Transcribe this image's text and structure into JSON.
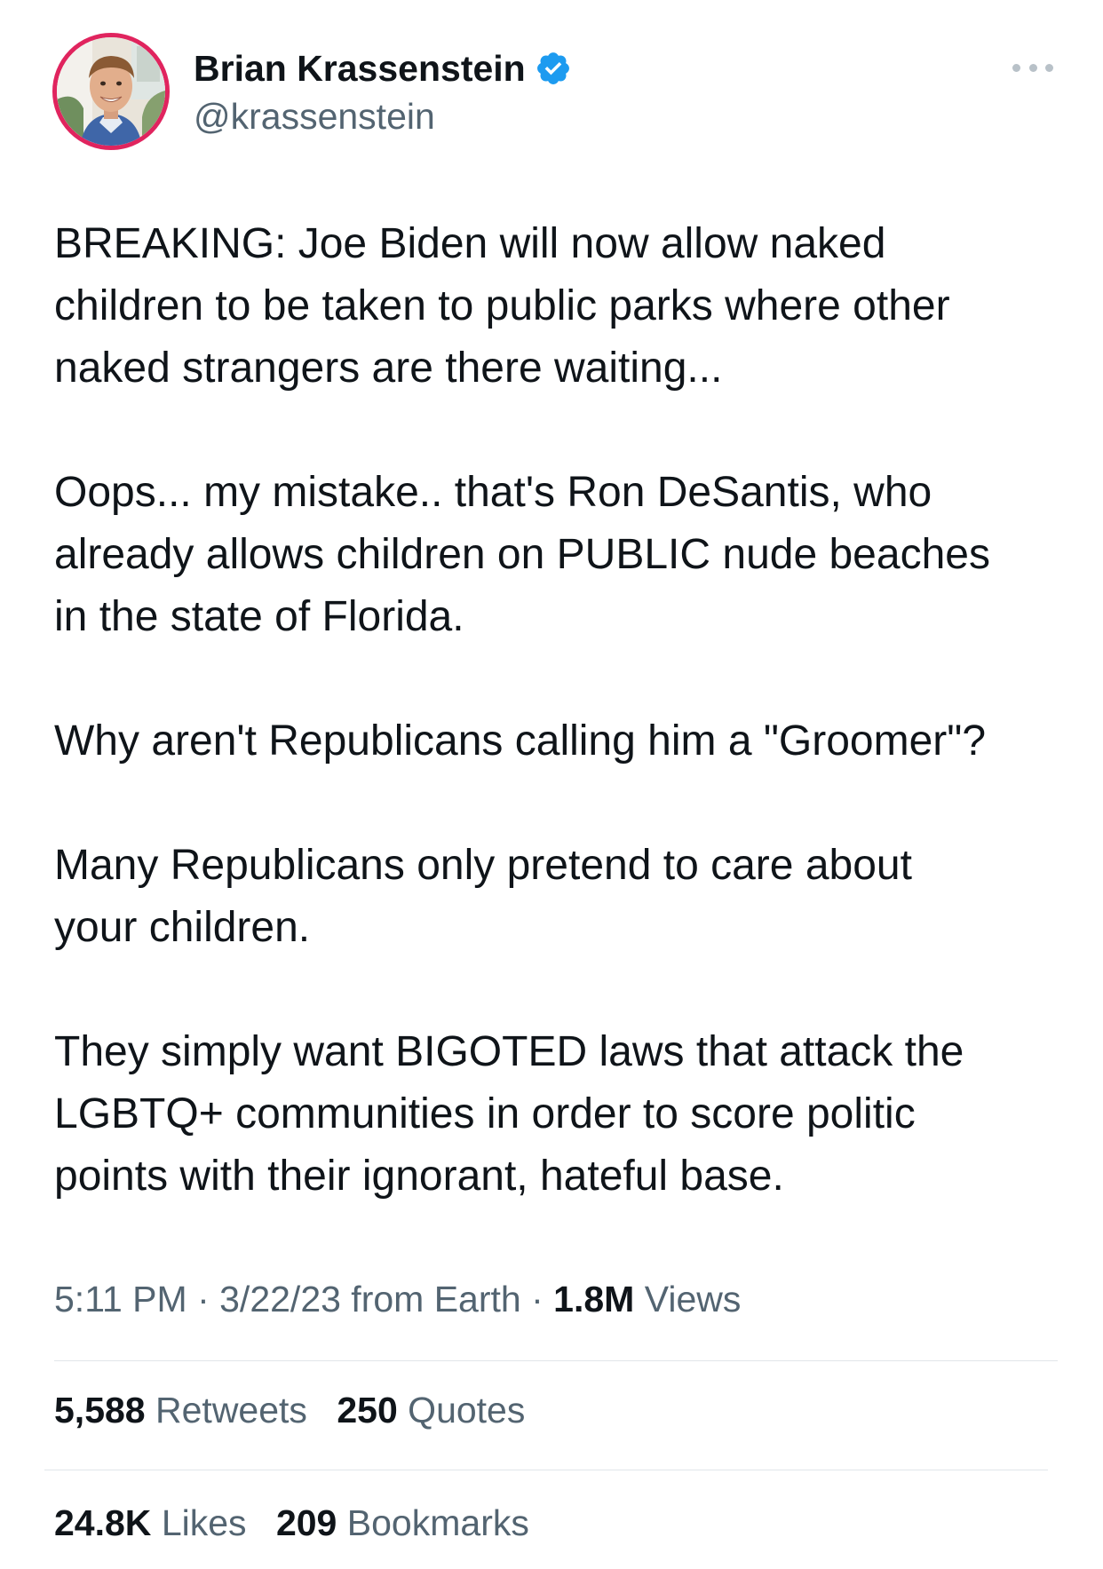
{
  "author": {
    "display_name": "Brian Krassenstein",
    "handle": "@krassenstein",
    "verified_icon": "verified-badge-icon",
    "avatar": "profile-photo"
  },
  "menu": {
    "icon": "more-options-icon"
  },
  "tweet": {
    "paragraphs": [
      "BREAKING: Joe Biden will now allow naked\nchildren to be taken to public parks where other\nnaked strangers are there waiting...",
      "Oops... my mistake.. that's Ron DeSantis, who\nalready allows children on PUBLIC nude beaches\nin the state of Florida.",
      "Why aren't Republicans calling him a \"Groomer\"?",
      "Many Republicans only pretend to care about\nyour children.",
      "They simply want BIGOTED laws that attack the\nLGBTQ+ communities in order to score politic\npoints with their ignorant, hateful base."
    ]
  },
  "meta": {
    "time": "5:11 PM",
    "separator": "·",
    "date_source": "3/22/23 from Earth",
    "views_count": "1.8M",
    "views_label": "Views"
  },
  "stats": {
    "retweets_count": "5,588",
    "retweets_label": "Retweets",
    "quotes_count": "250",
    "quotes_label": "Quotes",
    "likes_count": "24.8K",
    "likes_label": "Likes",
    "bookmarks_count": "209",
    "bookmarks_label": "Bookmarks"
  },
  "colors": {
    "text": "#0f1419",
    "secondary": "#536471",
    "verified": "#1d9bf0",
    "avatar_ring": "#e0245e",
    "divider": "#e1e6ea"
  }
}
